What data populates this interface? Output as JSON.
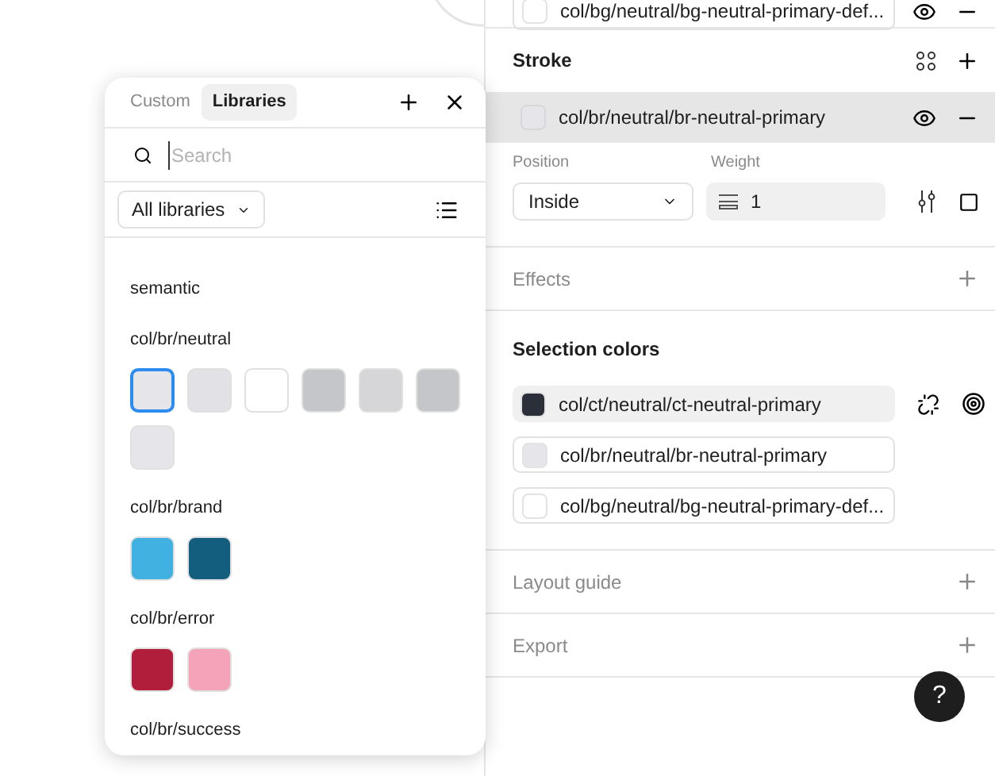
{
  "fill_row": {
    "name": "col/bg/neutral/bg-neutral-primary-def...",
    "color": "#ffffff"
  },
  "stroke": {
    "title": "Stroke",
    "row": {
      "name": "col/br/neutral/br-neutral-primary",
      "color": "#e5e5ea",
      "selected": true
    },
    "position_label": "Position",
    "position": "Inside",
    "weight_label": "Weight",
    "weight": "1"
  },
  "effects": {
    "title": "Effects"
  },
  "selection_colors": {
    "title": "Selection colors",
    "items": [
      {
        "name": "col/ct/neutral/ct-neutral-primary",
        "color": "#2a2f3a",
        "selected": true
      },
      {
        "name": "col/br/neutral/br-neutral-primary",
        "color": "#e5e5ea",
        "selected": false
      },
      {
        "name": "col/bg/neutral/bg-neutral-primary-def...",
        "color": "#ffffff",
        "selected": false
      }
    ]
  },
  "collapsed_sections": [
    {
      "title": "Layout guide"
    },
    {
      "title": "Export"
    }
  ],
  "help": "?",
  "picker": {
    "tabs": [
      {
        "label": "Custom",
        "selected": false
      },
      {
        "label": "Libraries",
        "selected": true
      }
    ],
    "search": {
      "placeholder": "Search"
    },
    "filter": "All libraries",
    "groups": [
      {
        "title": "semantic"
      },
      {
        "title": "col/br/neutral",
        "swatches": [
          {
            "color": "#e5e5ea",
            "selected": true
          },
          {
            "color": "#e2e2e6",
            "selected": false
          },
          {
            "color": "#ffffff",
            "selected": false
          },
          {
            "color": "#c5c6ca",
            "selected": false
          },
          {
            "color": "#d6d6d9",
            "selected": false
          },
          {
            "color": "#c5c6ca",
            "selected": false
          },
          {
            "color": "#e5e5ea",
            "selected": false
          }
        ]
      },
      {
        "title": "col/br/brand",
        "swatches": [
          {
            "color": "#41b1e1",
            "selected": false
          },
          {
            "color": "#135d7f",
            "selected": false
          }
        ]
      },
      {
        "title": "col/br/error",
        "swatches": [
          {
            "color": "#b01e3b",
            "selected": false
          },
          {
            "color": "#f5a3b8",
            "selected": false
          }
        ]
      },
      {
        "title": "col/br/success"
      }
    ]
  }
}
